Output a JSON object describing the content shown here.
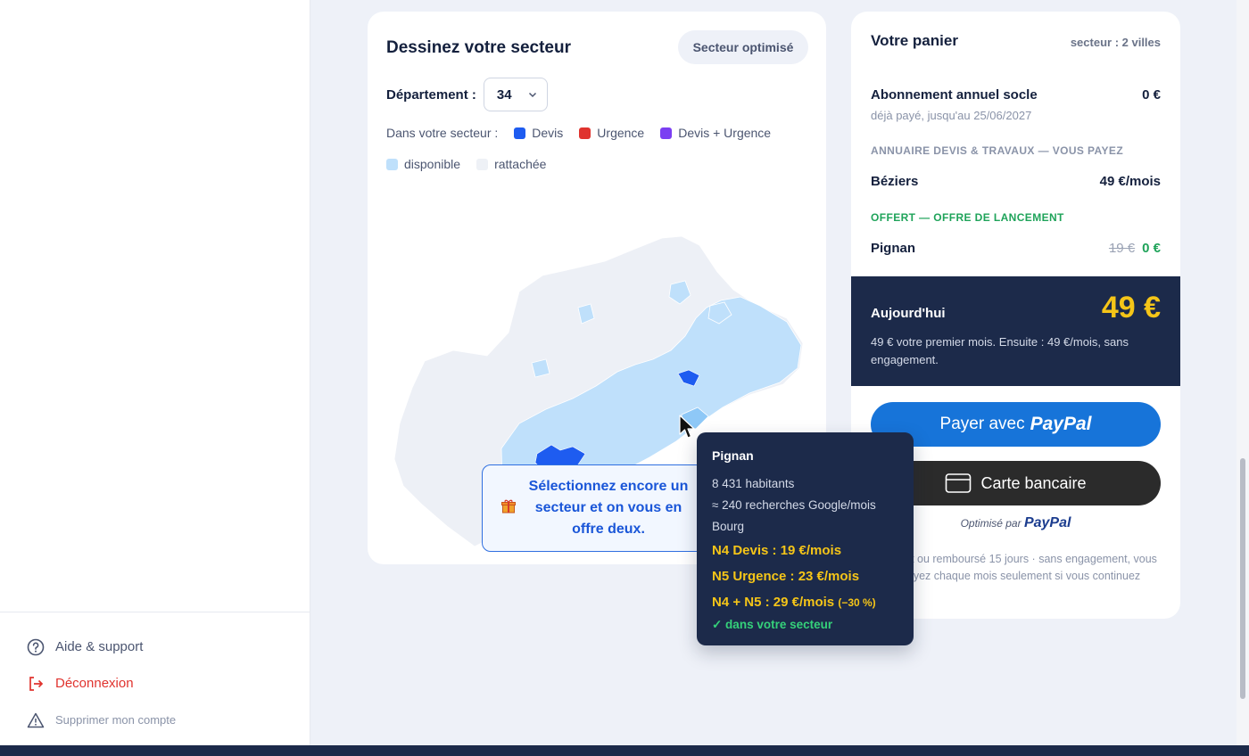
{
  "sidebar": {
    "help_label": "Aide & support",
    "logout_label": "Déconnexion",
    "delete_label": "Supprimer mon compte"
  },
  "map_card": {
    "title": "Dessinez votre secteur",
    "optimize_button": "Secteur optimisé",
    "department_label": "Département :",
    "department_value": "34",
    "legend_caption": "Dans votre secteur :",
    "legend": [
      {
        "label": "Devis",
        "color": "#1e5cf0"
      },
      {
        "label": "Urgence",
        "color": "#e0332e"
      },
      {
        "label": "Devis + Urgence",
        "color": "#7b3ff2"
      },
      {
        "label": "disponible",
        "color": "#bfe0fb"
      },
      {
        "label": "rattachée",
        "color": "#eef1f6"
      }
    ],
    "offer_text": "Sélectionnez encore un secteur et on vous en offre deux."
  },
  "tooltip": {
    "city": "Pignan",
    "inhabitants": "8 431 habitants",
    "searches": "≈ 240 recherches Google/mois",
    "type": "Bourg",
    "price_devis": "N4 Devis : 19 €/mois",
    "price_urgence": "N5 Urgence : 23 €/mois",
    "price_both": "N4 + N5 : 29 €/mois",
    "discount": "(−30 %)",
    "in_sector": "✓ dans votre secteur"
  },
  "cart": {
    "title": "Votre panier",
    "subtitle": "secteur : 2 villes",
    "base_label": "Abonnement annuel socle",
    "base_price": "0 €",
    "base_note": "déjà payé, jusqu'au 25/06/2027",
    "section_paid": "ANNUAIRE DEVIS & TRAVAUX — VOUS PAYEZ",
    "paid_city": "Béziers",
    "paid_price": "49 €/mois",
    "section_free": "OFFERT — OFFRE DE LANCEMENT",
    "free_city": "Pignan",
    "free_old_price": "19 €",
    "free_price": "0 €",
    "today_label": "Aujourd'hui",
    "today_amount": "49 €",
    "today_note": "49 € votre premier mois. Ensuite : 49 €/mois, sans engagement.",
    "paypal_prefix": "Payer avec",
    "paypal_brand": "PayPal",
    "card_label": "Carte bancaire",
    "powered_prefix": "Optimisé par",
    "powered_brand": "PayPal",
    "guarantee": "Satisfait ou remboursé 15 jours · sans engagement, vous repayez chaque mois seulement si vous continuez"
  },
  "colors": {
    "navy": "#1c2a4a",
    "accent_yellow": "#f5c518",
    "paypal_blue": "#1774d9",
    "free_green": "#1fa35a"
  }
}
